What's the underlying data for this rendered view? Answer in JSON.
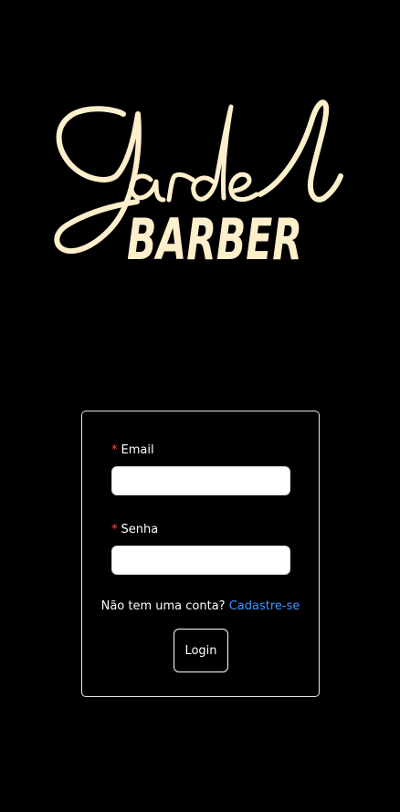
{
  "logo": {
    "script_text": "Jardel",
    "block_text": "BARBER",
    "color": "#fdefcb"
  },
  "form": {
    "email": {
      "required_mark": "*",
      "label": "Email",
      "value": "",
      "placeholder": ""
    },
    "password": {
      "required_mark": "*",
      "label": "Senha",
      "value": "",
      "placeholder": ""
    },
    "signup_prompt": "Não tem uma conta?",
    "signup_link": "Cadastre-se",
    "submit_label": "Login"
  },
  "colors": {
    "background": "#000000",
    "card_border": "#e6e6e6",
    "link": "#4096ff",
    "required": "#ff4d4f",
    "text": "#ffffff"
  }
}
